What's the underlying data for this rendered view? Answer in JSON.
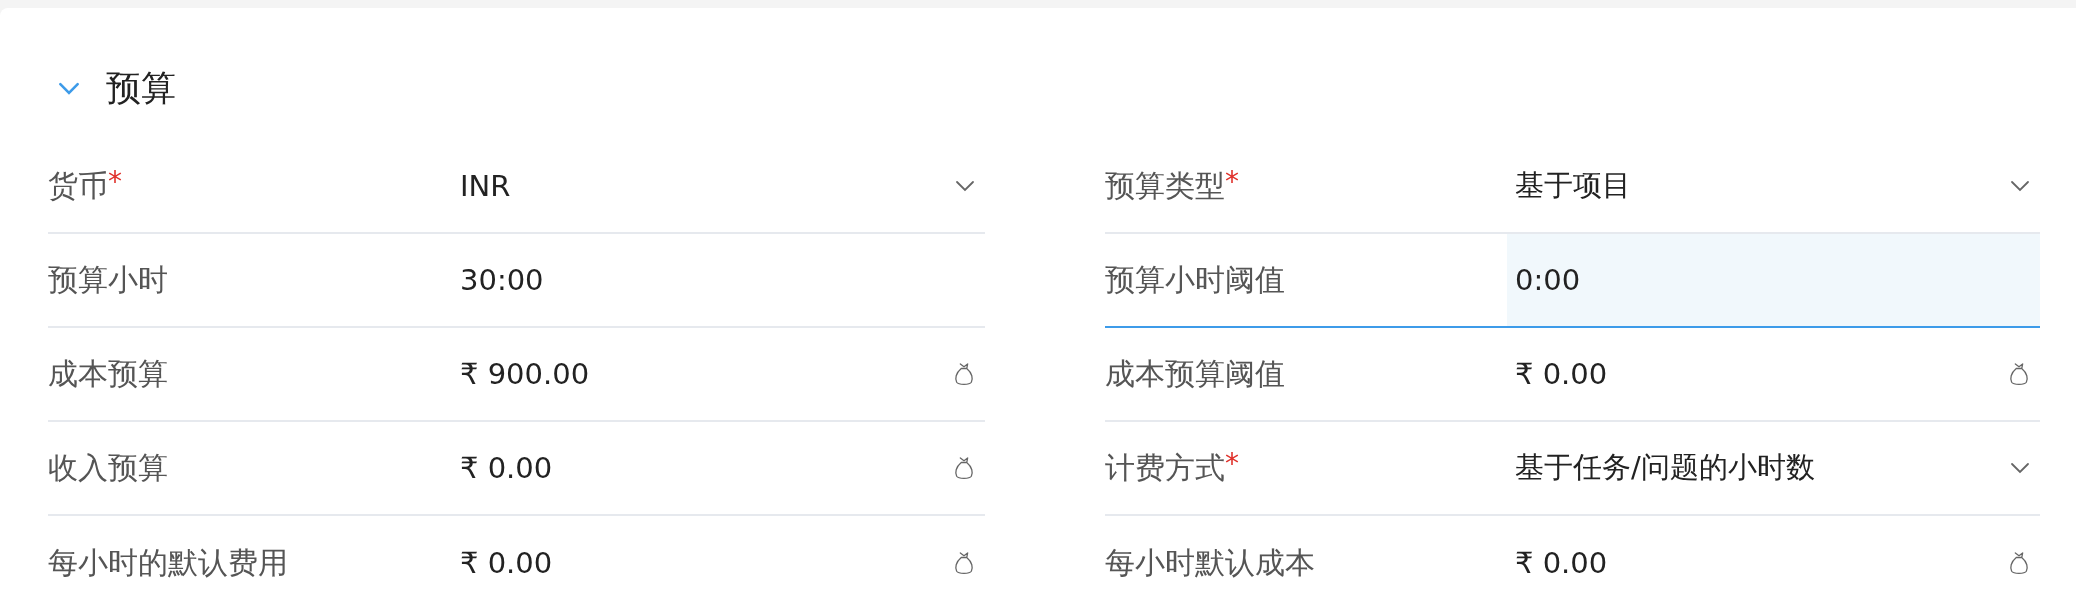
{
  "section": {
    "title": "预算",
    "expanded": true
  },
  "columns": [
    [
      {
        "label": "货币",
        "required_mark": "*",
        "kind": "select",
        "value": "INR",
        "focused": false
      },
      {
        "label": "预算小时",
        "kind": "text",
        "value": "30:00",
        "focused": false
      },
      {
        "label": "成本预算",
        "kind": "currency",
        "value": "₹ 900.00",
        "focused": false
      },
      {
        "label": "收入预算",
        "kind": "currency",
        "value": "₹ 0.00",
        "focused": false
      },
      {
        "label": "每小时的默认费用",
        "kind": "currency",
        "value": "₹ 0.00",
        "focused": false
      }
    ],
    [
      {
        "label": "预算类型",
        "required_mark": "*",
        "kind": "select",
        "value": "基于项目",
        "focused": false
      },
      {
        "label": "预算小时阈值",
        "kind": "text",
        "value": "0:00",
        "focused": true
      },
      {
        "label": "成本预算阈值",
        "kind": "currency",
        "value": "₹ 0.00",
        "focused": false
      },
      {
        "label": "计费方式",
        "required_mark": "*",
        "kind": "select",
        "value": "基于任务/问题的小时数",
        "focused": false
      },
      {
        "label": "每小时默认成本",
        "kind": "currency",
        "value": "₹ 0.00",
        "focused": false
      }
    ]
  ]
}
